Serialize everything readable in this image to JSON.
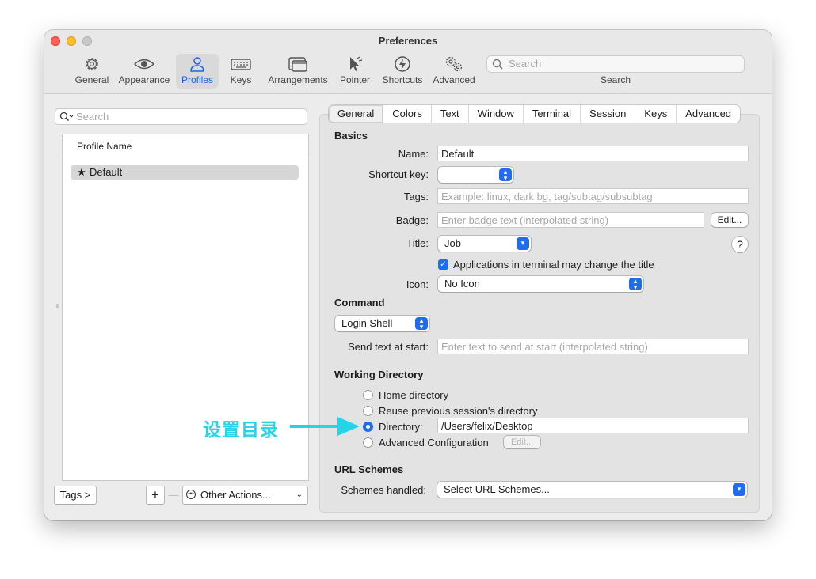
{
  "window": {
    "title": "Preferences",
    "traffic_lights": {
      "close": "#fe5f57",
      "minimize": "#febc2e",
      "zoom": "#c8c8c8"
    }
  },
  "toolbar": {
    "items": [
      {
        "label": "General",
        "icon": "gear-icon"
      },
      {
        "label": "Appearance",
        "icon": "eye-icon"
      },
      {
        "label": "Profiles",
        "icon": "person-icon",
        "selected": true
      },
      {
        "label": "Keys",
        "icon": "keyboard-icon"
      },
      {
        "label": "Arrangements",
        "icon": "windows-icon"
      },
      {
        "label": "Pointer",
        "icon": "cursor-icon"
      },
      {
        "label": "Shortcuts",
        "icon": "bolt-icon"
      },
      {
        "label": "Advanced",
        "icon": "gears-icon"
      }
    ],
    "search_placeholder": "Search",
    "search_caption": "Search"
  },
  "sidebar": {
    "search_placeholder": "Search",
    "column_header": "Profile Name",
    "profiles": [
      {
        "name": "Default",
        "starred": true
      }
    ],
    "tags_button": "Tags >",
    "add_button": "+",
    "remove_button": "—",
    "other_actions": "Other Actions..."
  },
  "tabs": [
    "General",
    "Colors",
    "Text",
    "Window",
    "Terminal",
    "Session",
    "Keys",
    "Advanced"
  ],
  "basics": {
    "heading": "Basics",
    "name_label": "Name:",
    "name_value": "Default",
    "shortcut_label": "Shortcut key:",
    "tags_label": "Tags:",
    "tags_placeholder": "Example: linux, dark bg, tag/subtag/subsubtag",
    "badge_label": "Badge:",
    "badge_placeholder": "Enter badge text (interpolated string)",
    "badge_edit": "Edit...",
    "title_label": "Title:",
    "title_value": "Job",
    "help": "?",
    "apps_change_title": "Applications in terminal may change the title",
    "icon_label": "Icon:",
    "icon_value": "No Icon"
  },
  "command": {
    "heading": "Command",
    "shell_value": "Login Shell",
    "send_text_label": "Send text at start:",
    "send_text_placeholder": "Enter text to send at start (interpolated string)"
  },
  "working_directory": {
    "heading": "Working Directory",
    "home": "Home directory",
    "reuse": "Reuse previous session's directory",
    "directory": "Directory:",
    "directory_value": "/Users/felix/Desktop",
    "advanced": "Advanced Configuration",
    "advanced_edit": "Edit...",
    "selected": "directory"
  },
  "url_schemes": {
    "heading": "URL Schemes",
    "schemes_label": "Schemes handled:",
    "schemes_value": "Select URL Schemes..."
  },
  "annotation": {
    "text": "设置目录",
    "color": "#27d3e6"
  },
  "colors": {
    "accent": "#1f6cf0",
    "selected_tab_text": "#1f62e0"
  }
}
